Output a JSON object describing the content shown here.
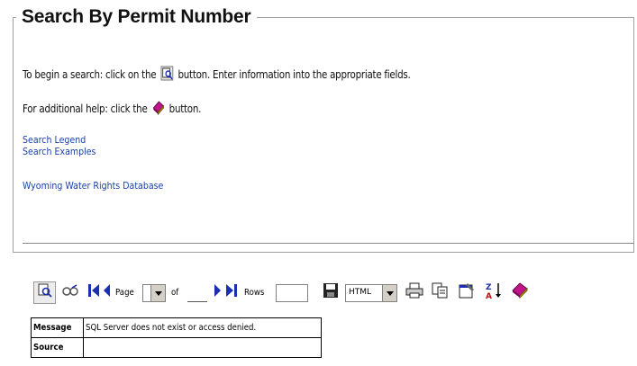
{
  "section": {
    "title": "Search By Permit Number"
  },
  "instructions": {
    "line1_before": "To begin a search: click on the",
    "line1_after": "button. Enter information into the appropriate fields.",
    "line2_before": "For additional help: click the",
    "line2_after": "button."
  },
  "links": [
    {
      "label": "Search Legend"
    },
    {
      "label": "Search Examples"
    },
    {
      "label": "Wyoming Water Rights Database"
    }
  ],
  "toolbar": {
    "page_label": "Page",
    "of_label": "of",
    "rows_label": "Rows",
    "page_value": "",
    "total_pages": "",
    "rows_value": "",
    "format_value": "HTML",
    "icons": [
      "search-icon",
      "query-icon",
      "first-page-icon",
      "previous-page-icon",
      "next-page-icon",
      "last-page-icon",
      "save-icon",
      "print-icon",
      "copy-icon",
      "properties-icon",
      "sort-icon",
      "help-icon"
    ]
  },
  "message_table": {
    "rows": [
      {
        "header": "Message",
        "value": "SQL Server does not exist or access denied."
      },
      {
        "header": "Source",
        "value": ""
      }
    ]
  },
  "colors": {
    "link": "#1a3fa8",
    "nav_arrow": "#1b2fb0",
    "help_book": "#c0148a"
  }
}
